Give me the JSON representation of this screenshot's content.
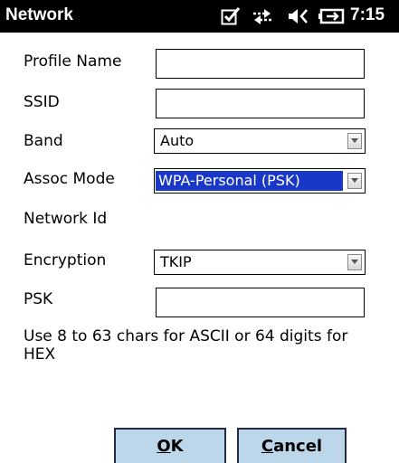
{
  "window": {
    "title": "Network",
    "time": "7:15",
    "status_icons": [
      "ok-checkbox-icon",
      "sync-arrows-icon",
      "speaker-icon",
      "battery-icon"
    ]
  },
  "form": {
    "profile_name": {
      "label": "Profile Name",
      "value": ""
    },
    "ssid": {
      "label": "SSID",
      "value": ""
    },
    "band": {
      "label": "Band",
      "value": "Auto"
    },
    "assoc_mode": {
      "label": "Assoc Mode",
      "value": "WPA-Personal (PSK)"
    },
    "network_id": {
      "label": "Network Id"
    },
    "encryption": {
      "label": "Encryption",
      "value": "TKIP"
    },
    "psk": {
      "label": "PSK",
      "value": ""
    }
  },
  "help_text": "Use 8 to 63 chars for ASCII or 64 digits for HEX",
  "buttons": {
    "ok": {
      "mnemonic": "O",
      "rest": "K"
    },
    "cancel": {
      "mnemonic": "C",
      "rest": "ancel"
    }
  },
  "colors": {
    "titlebar_bg": "#000000",
    "selection": "#1a38c8",
    "button_bg": "#bcd6ea"
  }
}
